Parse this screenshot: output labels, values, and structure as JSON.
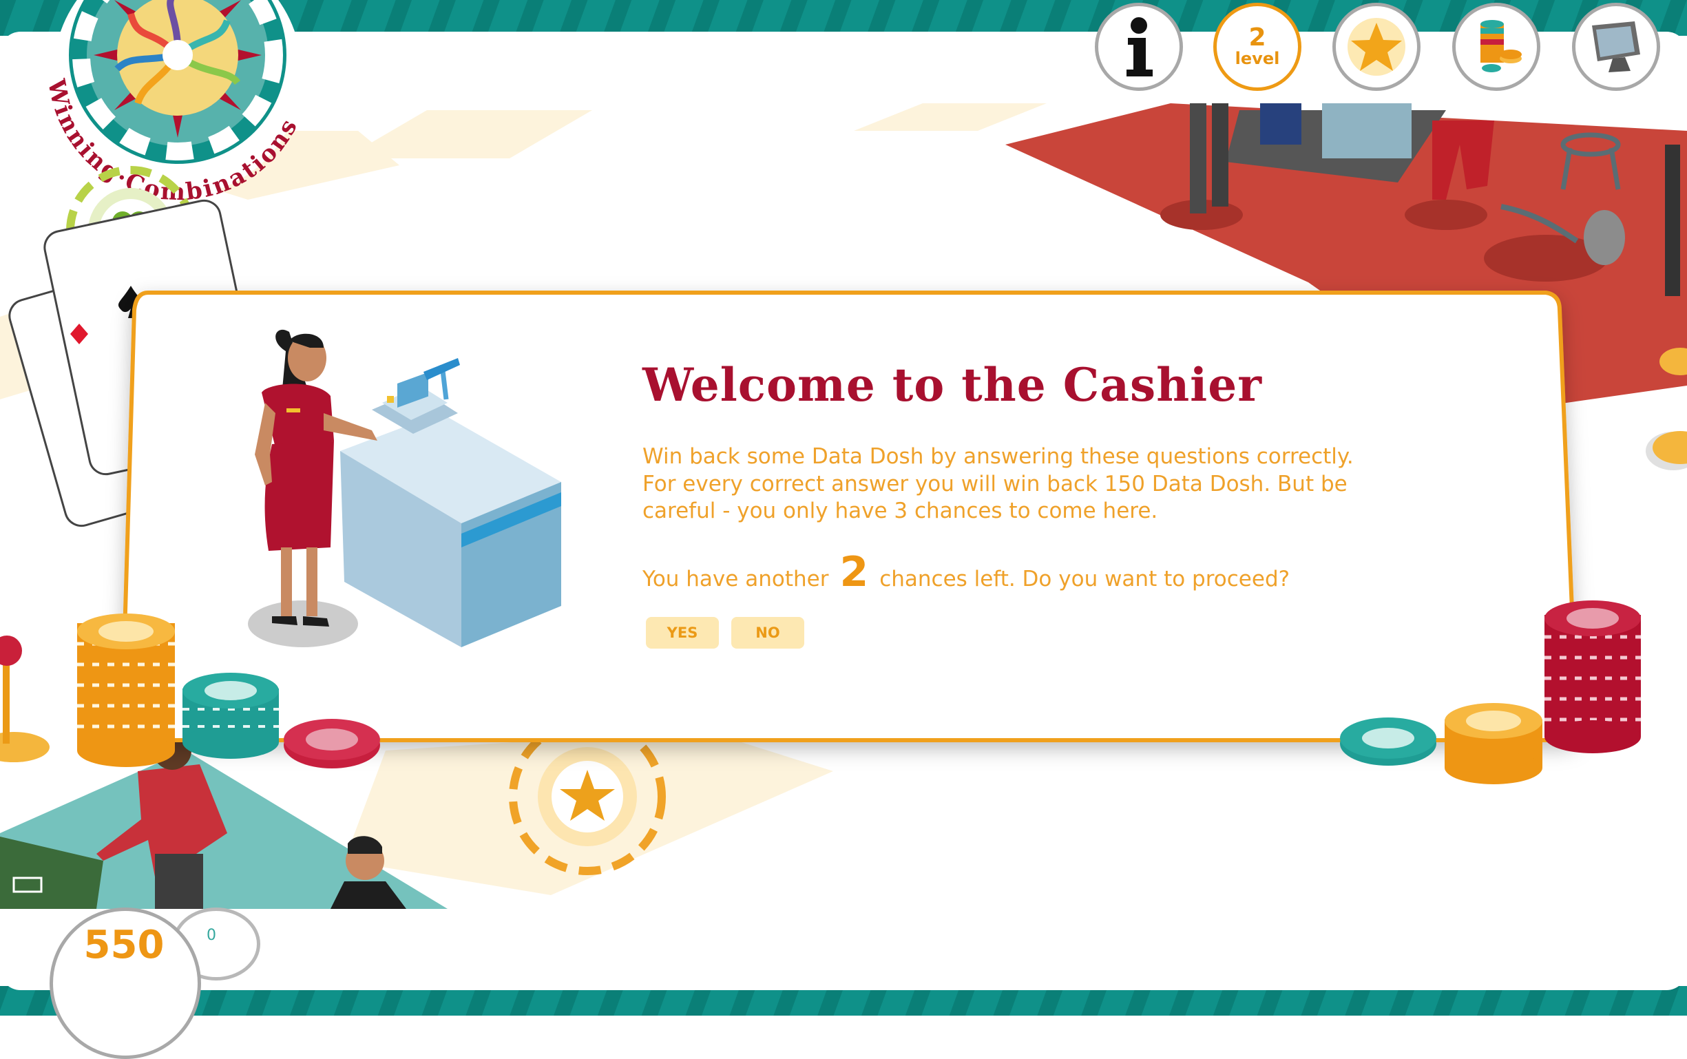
{
  "logo": {
    "text": "Winning·Combinations"
  },
  "nav": {
    "level_number": "2",
    "level_label": "level"
  },
  "modal": {
    "title": "Welcome to the Cashier",
    "paragraph_lines": [
      "Win back some Data Dosh by answering these questions correctly.",
      "For every correct answer you will win back 150 Data Dosh. But be",
      "careful - you only have 3 chances to come here."
    ],
    "chances_prefix": "You have another",
    "chances_number": "2",
    "chances_suffix": "chances left. Do you want to proceed?",
    "yes_label": "YES",
    "no_label": "NO"
  },
  "score": {
    "value": "550",
    "bubble": "0"
  },
  "colors": {
    "teal": "#0c8f86",
    "orange": "#ee9614",
    "crimson": "#a8102f",
    "red_floor": "#c9453a"
  }
}
